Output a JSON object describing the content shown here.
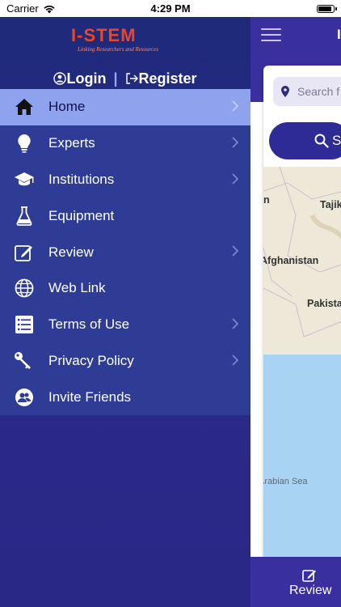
{
  "status_bar": {
    "carrier": "Carrier",
    "time": "4:29 PM"
  },
  "logo": {
    "text": "I-STEM",
    "tagline": "Linking Researchers and Resources"
  },
  "auth": {
    "login": "Login",
    "separator": "|",
    "register": "Register"
  },
  "menu": {
    "items": [
      {
        "label": "Home",
        "icon": "home-icon",
        "active": true,
        "chevron": true
      },
      {
        "label": "Experts",
        "icon": "lightbulb-icon",
        "chevron": true
      },
      {
        "label": "Institutions",
        "icon": "graduation-cap-icon",
        "chevron": true
      },
      {
        "label": "Equipment",
        "icon": "flask-icon",
        "chevron": false
      },
      {
        "label": "Review",
        "icon": "edit-icon",
        "chevron": true
      },
      {
        "label": "Web Link",
        "icon": "globe-icon",
        "chevron": false
      },
      {
        "label": "Terms of Use",
        "icon": "list-icon",
        "chevron": true
      },
      {
        "label": "Privacy Policy",
        "icon": "key-icon",
        "chevron": true
      },
      {
        "label": "Invite Friends",
        "icon": "users-icon",
        "chevron": false
      }
    ]
  },
  "background_app": {
    "title_stub": "I",
    "search_placeholder": "Search f",
    "search_button_label": "Se",
    "map_labels": [
      "n",
      "Tajik",
      "Afghanistan",
      "Pakista",
      "Arabian Sea"
    ],
    "tab_label": "Review"
  },
  "colors": {
    "drawer": "#2b2a8c",
    "menu_bg": "#2e3c96",
    "active_item": "#8fa2ee",
    "header": "#3a2f9e"
  }
}
